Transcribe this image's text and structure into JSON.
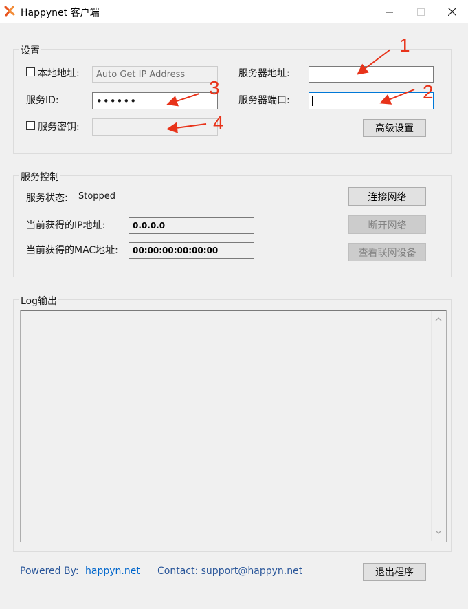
{
  "window": {
    "title": "Happynet 客户端",
    "controls": {
      "minimize": "—",
      "maximize": "☐",
      "close": "✕"
    }
  },
  "settings": {
    "group_title": "设置",
    "local_address_label": "本地地址:",
    "local_address_placeholder": "Auto Get IP Address",
    "server_address_label": "服务器地址:",
    "server_address_value": "",
    "service_id_label": "服务ID:",
    "service_id_value": "••••••",
    "server_port_label": "服务器端口:",
    "server_port_value": "",
    "service_key_label": "服务密钥:",
    "service_key_value": "",
    "advanced_button": "高级设置"
  },
  "control": {
    "group_title": "服务控制",
    "status_label": "服务状态:",
    "status_value": "Stopped",
    "ip_label": "当前获得的IP地址:",
    "ip_value": "0.0.0.0",
    "mac_label": "当前获得的MAC地址:",
    "mac_value": "00:00:00:00:00:00",
    "connect_button": "连接网络",
    "disconnect_button": "断开网络",
    "view_devices_button": "查看联网设备"
  },
  "log": {
    "group_title": "Log输出",
    "content": ""
  },
  "footer": {
    "powered_by_label": "Powered By:",
    "powered_by_link": "happyn.net",
    "contact_label": "Contact: support@happyn.net",
    "exit_button": "退出程序"
  },
  "annotations": [
    "1",
    "2",
    "3",
    "4"
  ],
  "colors": {
    "annotation": "#e8331a",
    "footer_text": "#2b579a",
    "focus_border": "#0078d7",
    "app_icon": "#e8541e"
  },
  "icons": {
    "app": "happynet-logo-icon",
    "scroll_up": "chevron-up-icon",
    "scroll_down": "chevron-down-icon"
  }
}
